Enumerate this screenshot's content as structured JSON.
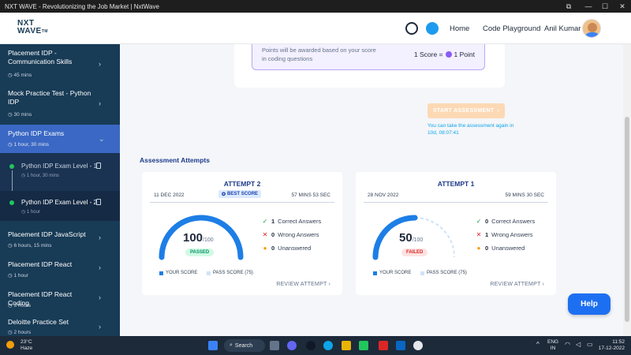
{
  "window": {
    "title": "NXT WAVE - Revolutionizing the Job Market | NxtWave"
  },
  "header": {
    "logo_line1": "NXT",
    "logo_line2": "WAVE",
    "logo_tm": "TM",
    "nav": {
      "home": "Home",
      "code_playground": "Code Playground"
    },
    "user_name": "Anil Kumar"
  },
  "sidebar": {
    "items": [
      {
        "title": "Placement IDP - Communication Skills",
        "duration": "45 mins"
      },
      {
        "title": "Mock Practice Test - Python IDP",
        "duration": "30 mins"
      },
      {
        "title": "Python IDP Exams",
        "duration": "1 hour, 30 mins",
        "active": true
      },
      {
        "title": "Placement IDP JavaScript",
        "duration": "6 hours, 15 mins"
      },
      {
        "title": "Placement IDP React",
        "duration": "1 hour"
      },
      {
        "title": "Placement IDP React Coding",
        "duration": "3 hours"
      },
      {
        "title": "Deloitte Practice Set",
        "duration": "2 hours"
      }
    ],
    "sub_items": [
      {
        "title": "Python IDP Exam Level - 1",
        "duration": "1 hour, 30 mins"
      },
      {
        "title": "Python IDP Exam Level - 2",
        "duration": "1 hour"
      }
    ]
  },
  "info": {
    "points_text": "Points will be awarded based on your score in coding questions",
    "score_label": "1 Score =",
    "point_label": "1 Point"
  },
  "start": {
    "button": "START ASSESSMENT",
    "note": "You can take the assessment again in 10d, 08:07:41"
  },
  "attempts": {
    "heading": "Assessment Attempts",
    "legend_your": "YOUR SCORE",
    "legend_pass": "PASS SCORE (75)",
    "review": "REVIEW ATTEMPT",
    "max": "/100",
    "list": [
      {
        "title": "ATTEMPT 2",
        "date": "11 DEC 2022",
        "duration": "57 MINS 53 SEC",
        "badge": "BEST SCORE",
        "score": "100",
        "score_value": 100,
        "status": "PASSED",
        "correct": "1",
        "correct_label": "Correct Answers",
        "wrong": "0",
        "wrong_label": "Wrong Answers",
        "unanswered": "0",
        "unanswered_label": "Unanswered"
      },
      {
        "title": "ATTEMPT 1",
        "date": "28 NOV 2022",
        "duration": "59 MINS 30 SEC",
        "score": "50",
        "score_value": 50,
        "status": "FAILED",
        "correct": "0",
        "correct_label": "Correct Answers",
        "wrong": "1",
        "wrong_label": "Wrong Answers",
        "unanswered": "0",
        "unanswered_label": "Unanswered"
      }
    ]
  },
  "help": {
    "label": "Help"
  },
  "taskbar": {
    "temp": "23°C",
    "weather": "Haze",
    "search": "Search",
    "lang": "ENG",
    "region": "IN",
    "time": "11:52",
    "date": "17-12-2022"
  },
  "colors": {
    "primary": "#1d6ff2",
    "sidebar": "#183b56",
    "sidebar_active": "#3a68c4",
    "gauge_score": "#1d7ee6",
    "gauge_pass": "#cfe3f7",
    "passed": "#059669",
    "failed": "#dc2626"
  }
}
